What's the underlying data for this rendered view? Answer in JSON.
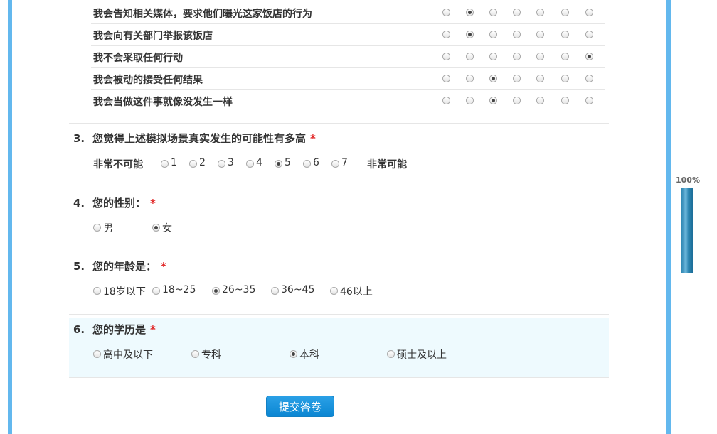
{
  "matrix": {
    "rows": [
      {
        "label": "我会告知相关媒体，要求他们曝光这家饭店的行为",
        "selected": 2
      },
      {
        "label": "我会向有关部门举报该饭店",
        "selected": 2
      },
      {
        "label": "我不会采取任何行动",
        "selected": 7
      },
      {
        "label": "我会被动的接受任何结果",
        "selected": 3
      },
      {
        "label": "我会当做这件事就像没发生一样",
        "selected": 3
      }
    ],
    "columns": 7
  },
  "q3": {
    "number": "3.",
    "title": "您觉得上述模拟场景真实发生的可能性有多高",
    "required": "*",
    "left_label": "非常不可能",
    "right_label": "非常可能",
    "options": [
      "1",
      "2",
      "3",
      "4",
      "5",
      "6",
      "7"
    ],
    "selected": "5"
  },
  "q4": {
    "number": "4.",
    "title": "您的性别：",
    "required": "*",
    "options": [
      "男",
      "女"
    ],
    "selected": "女"
  },
  "q5": {
    "number": "5.",
    "title": "您的年龄是：",
    "required": "*",
    "options": [
      "18岁以下",
      "18~25",
      "26~35",
      "36~45",
      "46以上"
    ],
    "selected": "26~35"
  },
  "q6": {
    "number": "6.",
    "title": "您的学历是",
    "required": "*",
    "options": [
      "高中及以下",
      "专科",
      "本科",
      "硕士及以上"
    ],
    "selected": "本科"
  },
  "submit": {
    "label": "提交答卷"
  },
  "progress": {
    "label": "100%",
    "value": 100
  },
  "colors": {
    "accent": "#63b8ee",
    "button": "#0b86d2",
    "required": "#e02020",
    "highlight": "#eefafe"
  }
}
